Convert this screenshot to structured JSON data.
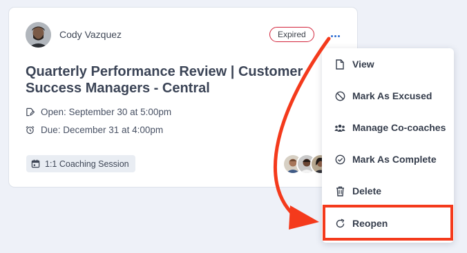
{
  "card": {
    "owner_name": "Cody Vazquez",
    "status": "Expired",
    "title": "Quarterly Performance Review | Customer Success Managers - Central",
    "open_label": "Open: September 30 at 5:00pm",
    "due_label": "Due: December 31 at 4:00pm",
    "session_type": "1:1 Coaching Session",
    "participants": [
      "participant-avatar",
      "participant-avatar",
      "participant-avatar"
    ]
  },
  "menu": {
    "items": [
      {
        "label": "View",
        "icon": "document-icon"
      },
      {
        "label": "Mark As Excused",
        "icon": "ban-icon"
      },
      {
        "label": "Manage Co-coaches",
        "icon": "users-icon"
      },
      {
        "label": "Mark As Complete",
        "icon": "check-circle-icon"
      },
      {
        "label": "Delete",
        "icon": "trash-icon"
      },
      {
        "label": "Reopen",
        "icon": "redo-icon"
      }
    ],
    "highlighted_item": "Reopen"
  },
  "annotation": {
    "color": "#f43a1c",
    "arrow_icon": "curved-arrow-icon"
  },
  "colors": {
    "background": "#eef1f8",
    "card": "#ffffff",
    "status_border": "#d2233a",
    "accent": "#2e6dd1"
  }
}
